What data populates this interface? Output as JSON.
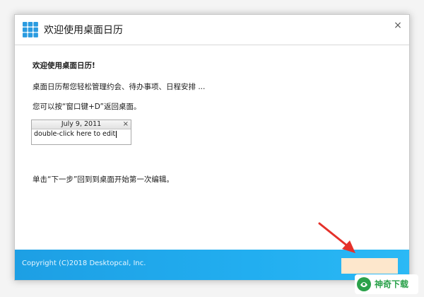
{
  "window": {
    "title": "欢迎使用桌面日历",
    "close_glyph": "×"
  },
  "content": {
    "greeting": "欢迎使用桌面日历!",
    "description": "桌面日历帮您轻松管理约会、待办事项、日程安排 ...",
    "hint": "您可以按“窗口键+D”返回桌面。",
    "next_instruction": "单击“下一步”回到到桌面开始第一次编辑。"
  },
  "widget": {
    "date": "July 9, 2011",
    "close_glyph": "×",
    "body_text": "double-click here to edit"
  },
  "footer": {
    "copyright": "Copyright (C)2018 Desktopcal, Inc.",
    "next_button_color": "#fde7cc",
    "bar_color": "#22aef0"
  },
  "watermark": {
    "text": "神奇下载",
    "color": "#2aa14a"
  },
  "icons": {
    "app_logo": "calendar-grid-icon",
    "close": "close-icon",
    "annotation_arrow": "red-arrow-icon"
  }
}
